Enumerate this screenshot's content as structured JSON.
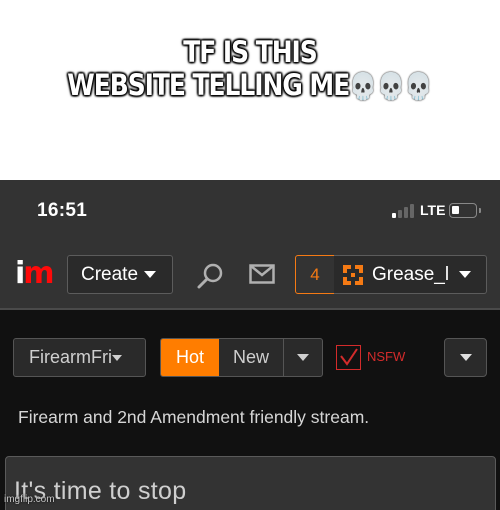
{
  "caption": {
    "line1": "TF IS THIS",
    "line2": "WEBSITE TELLING ME",
    "emoji": "💀💀💀"
  },
  "status_bar": {
    "time": "16:51",
    "network": "LTE",
    "signal_bars_on": 1,
    "signal_bars_total": 4,
    "battery_level": 0.25
  },
  "navbar": {
    "logo_i": "i",
    "logo_m": "m",
    "create_label": "Create",
    "notification_count": "4",
    "username": "Grease_l",
    "icons": [
      "search-icon",
      "mail-icon",
      "avatar-icon",
      "chevron-down-icon"
    ]
  },
  "stream_bar": {
    "stream_name": "FirearmFri",
    "sort_options": [
      {
        "label": "Hot",
        "active": true
      },
      {
        "label": "New",
        "active": false
      }
    ],
    "nsfw_checked": true,
    "nsfw_label": "NSFW"
  },
  "description": "Firearm and 2nd Amendment friendly stream.",
  "title_input": {
    "value": "It's time to stop"
  },
  "watermark": "imgflip.com",
  "colors": {
    "accent_orange": "#ff7d00",
    "notif_orange": "#f57a14",
    "logo_red": "#ff0a0a",
    "nsfw_red": "#d32b2b",
    "nav_bg": "#333333",
    "page_bg": "#111111"
  }
}
